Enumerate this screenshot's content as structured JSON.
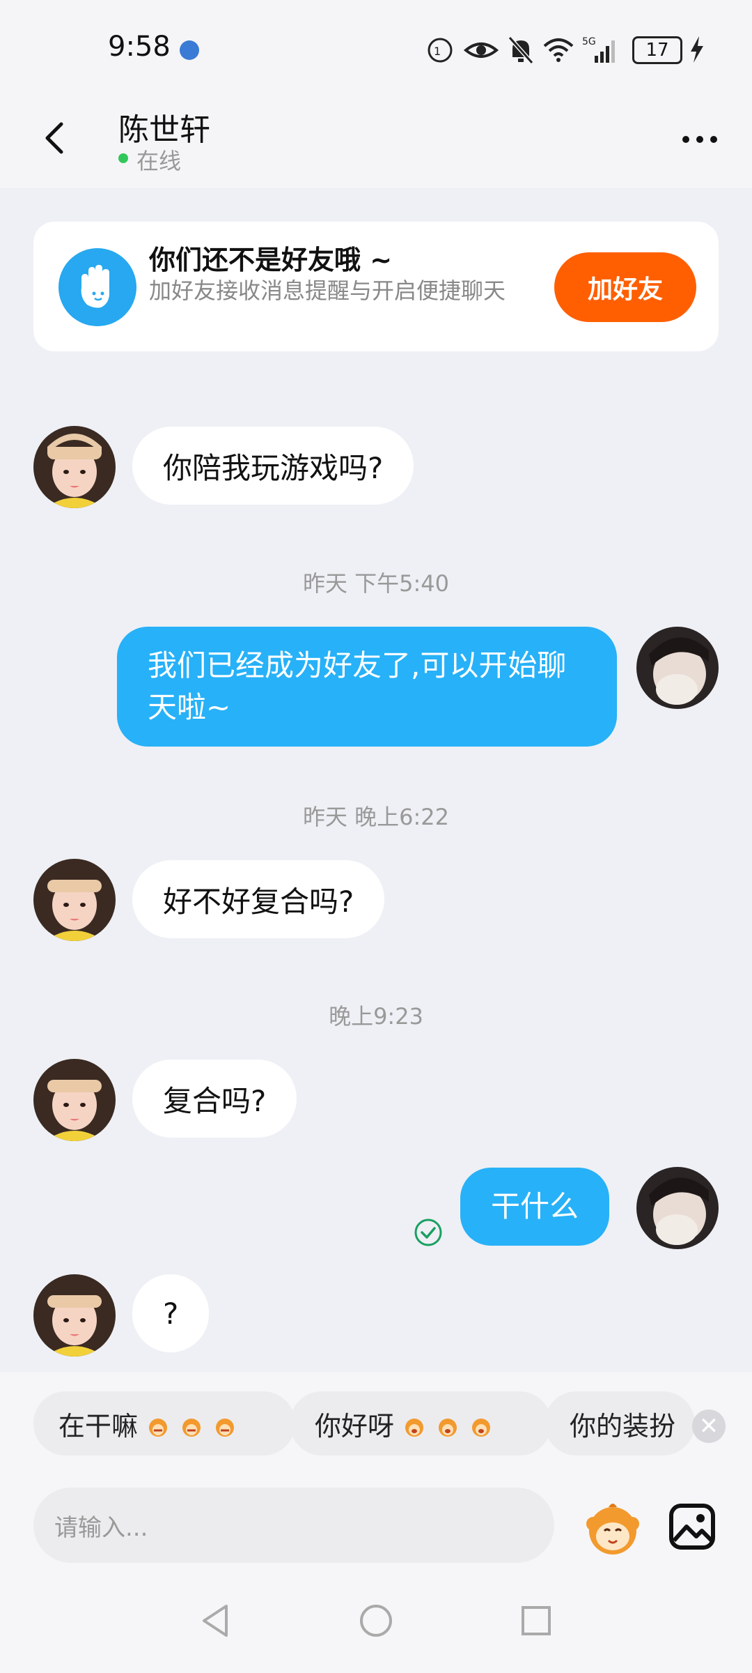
{
  "status_bar": {
    "time": "9:58",
    "battery": "17"
  },
  "header": {
    "contact_name": "陈世轩",
    "status": "在线"
  },
  "friend_card": {
    "title": "你们还不是好友哦 ~",
    "description": "加好友接收消息提醒与开启便捷聊天",
    "button": "加好友"
  },
  "messages": [
    {
      "side": "left",
      "text": "你陪我玩游戏吗?"
    },
    {
      "timestamp": "昨天 下午5:40"
    },
    {
      "side": "right",
      "text": "我们已经成为好友了,可以开始聊天啦~"
    },
    {
      "timestamp": "昨天 晚上6:22"
    },
    {
      "side": "left",
      "text": "好不好复合吗?"
    },
    {
      "timestamp": "晚上9:23"
    },
    {
      "side": "left",
      "text": "复合吗?"
    },
    {
      "side": "right",
      "text": "干什么"
    },
    {
      "side": "left",
      "text": "?"
    }
  ],
  "quick_replies": [
    "在干嘛",
    "你好呀",
    "你的装扮"
  ],
  "input": {
    "placeholder": "请输入..."
  },
  "colors": {
    "accent_blue": "#27b1f8",
    "add_friend_orange": "#ff5f00",
    "online_green": "#32c75a"
  }
}
